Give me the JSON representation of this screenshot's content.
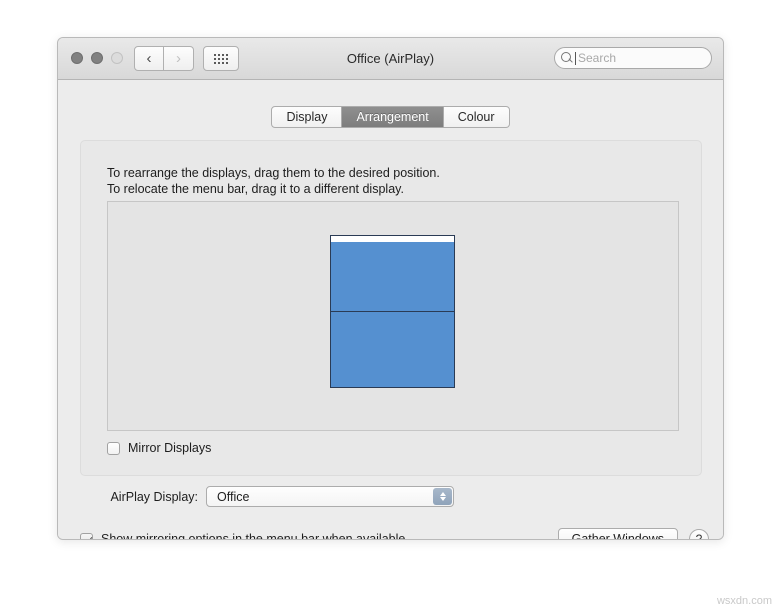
{
  "window": {
    "title": "Office (AirPlay)",
    "traffic_lights": [
      "close-button",
      "minimize-button",
      "zoom-button"
    ],
    "nav": {
      "back_icon": "chevron-left-icon",
      "back_glyph": "‹",
      "forward_icon": "chevron-right-icon",
      "forward_glyph": "›",
      "grid_icon": "grid-view-icon"
    },
    "search": {
      "icon": "search-icon",
      "placeholder": "Search",
      "value": ""
    }
  },
  "tabs": [
    {
      "label": "Display",
      "active": false
    },
    {
      "label": "Arrangement",
      "active": true
    },
    {
      "label": "Colour",
      "active": false
    }
  ],
  "panel": {
    "instruction_line1": "To rearrange the displays, drag them to the desired position.",
    "instruction_line2": "To relocate the menu bar, drag it to a different display.",
    "displays": [
      {
        "name": "display-top",
        "has_menu_bar": true
      },
      {
        "name": "display-bottom",
        "has_menu_bar": false
      }
    ],
    "mirror_displays": {
      "label": "Mirror Displays",
      "checked": false
    }
  },
  "airplay": {
    "label": "AirPlay Display:",
    "selected": "Office",
    "options": [
      "Office"
    ],
    "stepper_icon": "up-down-chevron-icon"
  },
  "footer": {
    "show_mirroring": {
      "label": "Show mirroring options in the menu bar when available",
      "checked": true
    },
    "gather_windows_label": "Gather Windows",
    "help_label": "?"
  },
  "watermark": "wsxdn.com",
  "colors": {
    "display_blue": "#5590d0",
    "display_border": "#2a3b55",
    "active_tab": "#8f8f8f",
    "stepper": "#8fa3ba",
    "window_bg": "#ececec"
  }
}
